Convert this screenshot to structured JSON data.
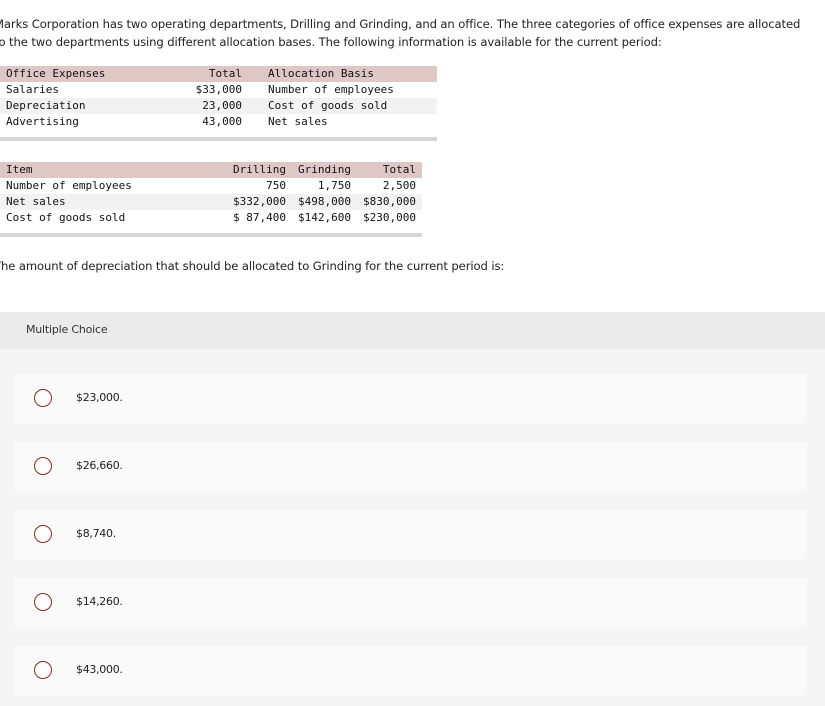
{
  "question": {
    "intro": "Marks Corporation has two operating departments, Drilling and Grinding, and an office. The three categories of office expenses are allocated to the two departments using different allocation bases. The following information is available for the current period:",
    "prompt": "The amount of depreciation that should be allocated to Grinding for the current period is:"
  },
  "office_table": {
    "headers": [
      "Office Expenses",
      "Total",
      "Allocation Basis"
    ],
    "rows": [
      [
        "Salaries",
        "$33,000",
        "Number of employees"
      ],
      [
        "Depreciation",
        "23,000",
        "Cost of goods sold"
      ],
      [
        "Advertising",
        "43,000",
        "Net sales"
      ]
    ]
  },
  "dept_table": {
    "headers": [
      "Item",
      "Drilling",
      "Grinding",
      "Total"
    ],
    "rows": [
      [
        "Number of employees",
        "750",
        "1,750",
        "2,500"
      ],
      [
        "Net sales",
        "$332,000",
        "$498,000",
        "$830,000"
      ],
      [
        "Cost of goods sold",
        "$ 87,400",
        "$142,600",
        "$230,000"
      ]
    ]
  },
  "multiple_choice": {
    "label": "Multiple Choice",
    "options": [
      "$23,000.",
      "$26,660.",
      "$8,740.",
      "$14,260.",
      "$43,000."
    ]
  },
  "colors": {
    "header_row": "#dec8c6",
    "radio_border": "#8a2a1f",
    "band": "#ebebeb"
  }
}
